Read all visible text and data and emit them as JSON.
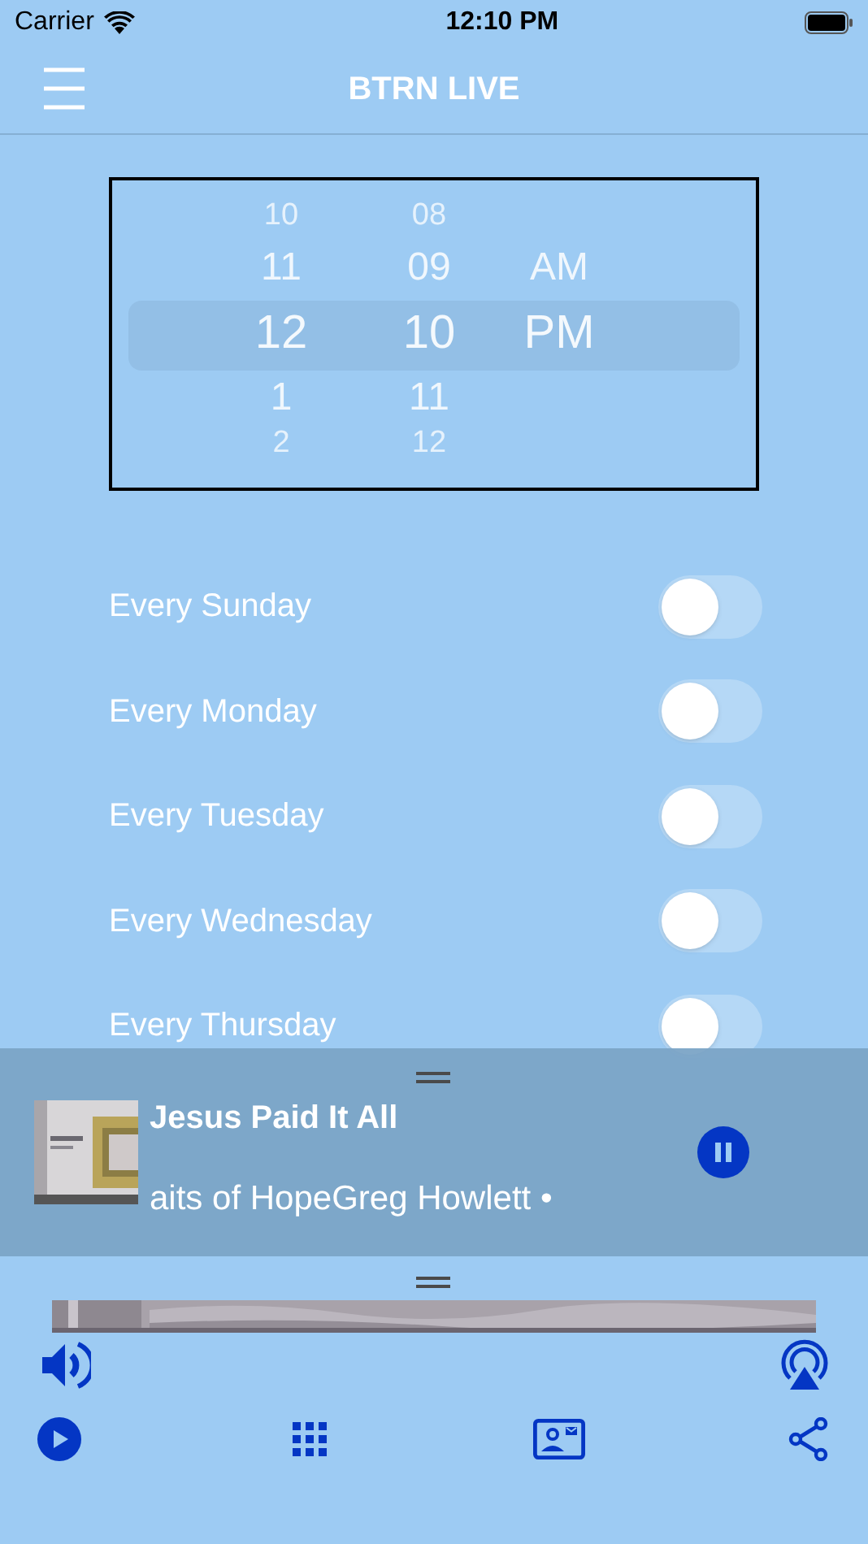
{
  "status_bar": {
    "carrier": "Carrier",
    "time": "12:10 PM"
  },
  "nav": {
    "title": "BTRN LIVE"
  },
  "time_picker": {
    "columns": [
      {
        "items": [
          {
            "text": "10",
            "selected": false
          },
          {
            "text": "11",
            "selected": false
          },
          {
            "text": "12",
            "selected": true
          },
          {
            "text": "1",
            "selected": false
          },
          {
            "text": "2",
            "selected": false
          }
        ]
      },
      {
        "items": [
          {
            "text": "08",
            "selected": false
          },
          {
            "text": "09",
            "selected": false
          },
          {
            "text": "10",
            "selected": true
          },
          {
            "text": "11",
            "selected": false
          },
          {
            "text": "12",
            "selected": false
          }
        ]
      },
      {
        "items": [
          {
            "text": "AM",
            "selected": false
          },
          {
            "text": "PM",
            "selected": true
          }
        ]
      }
    ]
  },
  "schedule": [
    {
      "label": "Every Sunday",
      "on": false
    },
    {
      "label": "Every Monday",
      "on": false
    },
    {
      "label": "Every Tuesday",
      "on": false
    },
    {
      "label": "Every Wednesday",
      "on": false
    },
    {
      "label": "Every Thursday",
      "on": false
    }
  ],
  "mini_player": {
    "title": "Jesus Paid It All",
    "subtitle": "aits of HopeGreg Howlett •",
    "playing": true
  }
}
